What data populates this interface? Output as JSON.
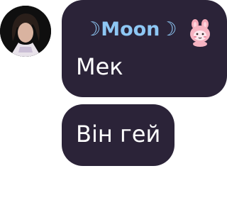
{
  "messages": [
    {
      "sender": "☽Moon☽",
      "text": "Мек"
    },
    {
      "text": "Він гей"
    }
  ],
  "icons": {
    "avatar": "user-avatar-photo",
    "sticker": "pink-bunny-sticker-icon"
  },
  "colors": {
    "bubble": "#2b2338",
    "sender_name": "#8ec7f4",
    "message_text": "#ffffff",
    "background": "#ffffff"
  }
}
